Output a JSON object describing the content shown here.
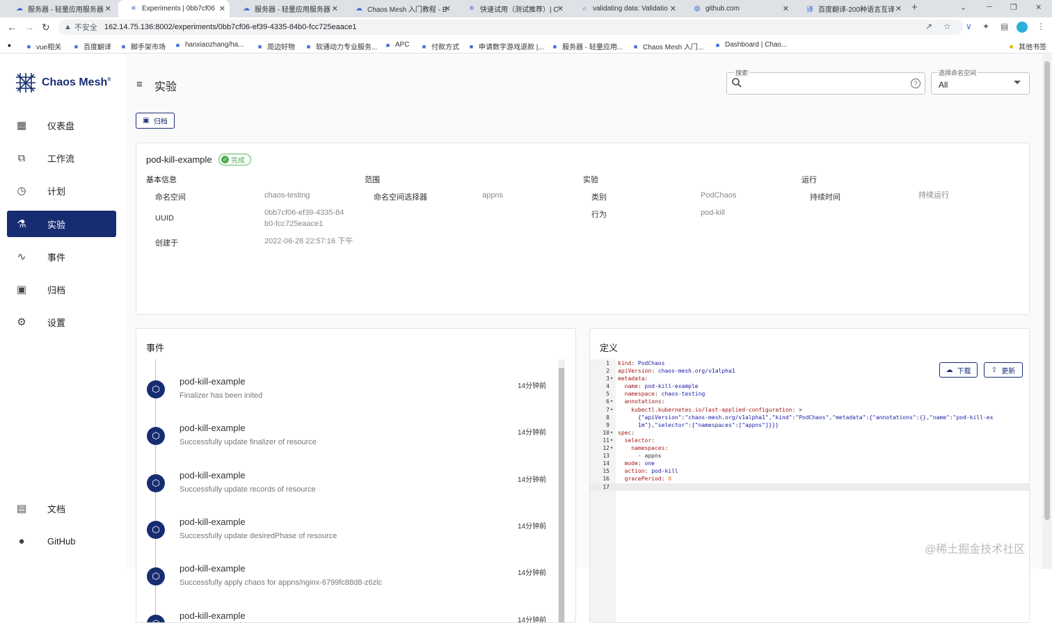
{
  "browser": {
    "tabs": [
      {
        "label": "服务器 - 轻量应用服务器",
        "icon": "cloud-icon"
      },
      {
        "label": "Experiments | 0bb7cf06",
        "icon": "chaos-mesh-icon",
        "active": true
      },
      {
        "label": "服务器 - 轻量应用服务器",
        "icon": "cloud-icon"
      },
      {
        "label": "Chaos Mesh 入门教程 - B",
        "icon": "cloud-icon"
      },
      {
        "label": "快速试用（测试推荐）| C",
        "icon": "chaos-mesh-icon"
      },
      {
        "label": "validating data: Validatio",
        "icon": "search-icon"
      },
      {
        "label": "github.com",
        "icon": "globe-icon"
      },
      {
        "label": "百度翻译-200种语言互译",
        "icon": "translate-icon"
      }
    ],
    "insecure_label": "不安全",
    "url": "162.14.75.136:8002/experiments/0bb7cf06-ef39-4335-84b0-fcc725eaace1",
    "bookmarks": [
      "vue相关",
      "百度翻译",
      "脚手架市场",
      "hanxiaozhang/ha...",
      "周边好物",
      "软通动力专业服务...",
      "APC",
      "付款方式",
      "申请数字游戏退款 |...",
      "服务器 - 轻量应用...",
      "Chaos Mesh 入门...",
      "Dashboard | Chao..."
    ],
    "other_bookmarks": "其他书签"
  },
  "sidebar": {
    "brand": "Chaos Mesh",
    "items": [
      {
        "label": "仪表盘",
        "icon": "dashboard-icon"
      },
      {
        "label": "工作流",
        "icon": "workflow-icon"
      },
      {
        "label": "计划",
        "icon": "clock-icon"
      },
      {
        "label": "实验",
        "icon": "flask-icon",
        "active": true
      },
      {
        "label": "事件",
        "icon": "trend-icon"
      },
      {
        "label": "归档",
        "icon": "archive-icon"
      },
      {
        "label": "设置",
        "icon": "gear-icon"
      }
    ],
    "bottom": [
      {
        "label": "文档",
        "icon": "book-icon"
      },
      {
        "label": "GitHub",
        "icon": "github-icon"
      }
    ]
  },
  "header": {
    "title": "实验",
    "search_legend": "搜索",
    "namespace_legend": "选择命名空间",
    "namespace_value": "All"
  },
  "archive_button": "归档",
  "experiment": {
    "name": "pod-kill-example",
    "status": "完成",
    "sections": {
      "basic": "基本信息",
      "scope": "范围",
      "experiment": "实验",
      "run": "运行"
    },
    "basic": [
      {
        "label": "命名空间",
        "value": "chaos-testing"
      },
      {
        "label": "UUID",
        "value": "0bb7cf06-ef39-4335-84b0-fcc725eaace1"
      },
      {
        "label": "创建于",
        "value": "2022-06-28 22:57:16 下午"
      }
    ],
    "scope": [
      {
        "label": "命名空间选择器",
        "value": "appns"
      }
    ],
    "exp": [
      {
        "label": "类别",
        "value": "PodChaos"
      },
      {
        "label": "行为",
        "value": "pod-kill"
      }
    ],
    "run": [
      {
        "label": "持续时间",
        "value": "持续运行"
      }
    ]
  },
  "events": {
    "title": "事件",
    "items": [
      {
        "name": "pod-kill-example",
        "message": "Finalizer has been inited",
        "time": "14分钟前"
      },
      {
        "name": "pod-kill-example",
        "message": "Successfully update finalizer of resource",
        "time": "14分钟前"
      },
      {
        "name": "pod-kill-example",
        "message": "Successfully update records of resource",
        "time": "14分钟前"
      },
      {
        "name": "pod-kill-example",
        "message": "Successfully update desiredPhase of resource",
        "time": "14分钟前"
      },
      {
        "name": "pod-kill-example",
        "message": "Successfully apply chaos for appns/nginx-6799fc88d8-z6zlc",
        "time": "14分钟前"
      },
      {
        "name": "pod-kill-example",
        "message": "",
        "time": "14分钟前"
      }
    ]
  },
  "definition": {
    "title": "定义",
    "download": "下载",
    "update": "更新",
    "lines": [
      "kind: PodChaos",
      "apiVersion: chaos-mesh.org/v1alpha1",
      "metadata:",
      "  name: pod-kill-example",
      "  namespace: chaos-testing",
      "  annotations:",
      "    kubectl.kubernetes.io/last-applied-configuration: >",
      "      {\"apiVersion\":\"chaos-mesh.org/v1alpha1\",\"kind\":\"PodChaos\",\"metadata\":{\"annotations\":{},\"name\":\"pod-kill-ex",
      "      1m\"},\"selector\":{\"namespaces\":[\"appns\"]}}}",
      "spec:",
      "  selector:",
      "    namespaces:",
      "      - appns",
      "  mode: one",
      "  action: pod-kill",
      "  gracePeriod: 0",
      ""
    ]
  },
  "watermark": "@稀土掘金技术社区"
}
